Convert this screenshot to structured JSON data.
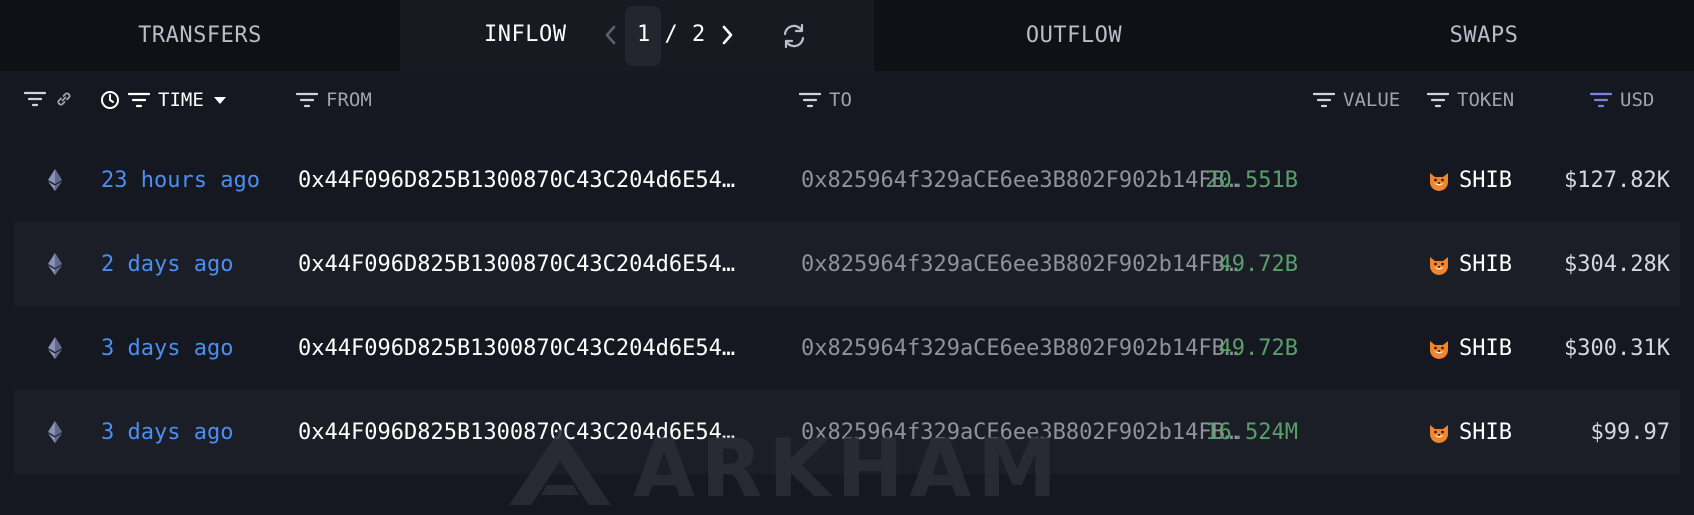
{
  "tabs": {
    "transfers": "TRANSFERS",
    "inflow": "INFLOW",
    "outflow": "OUTFLOW",
    "swaps": "SWAPS"
  },
  "pager": {
    "current": "1",
    "separator": "/",
    "total": "2",
    "display": "1 / 2"
  },
  "columns": {
    "time": "TIME",
    "from": "FROM",
    "to": "TO",
    "value": "VALUE",
    "token": "TOKEN",
    "usd": "USD"
  },
  "rows": [
    {
      "chain_icon": "ethereum-icon",
      "time": "23 hours ago",
      "from": "0x44F096D825B1300870C43C204d6E54…",
      "to": "0x825964f329aCE6ee3B802F902b14FB…",
      "value": "20.551B",
      "token_icon": "shib-icon",
      "token": "SHIB",
      "usd": "$127.82K"
    },
    {
      "chain_icon": "ethereum-icon",
      "time": "2 days ago",
      "from": "0x44F096D825B1300870C43C204d6E54…",
      "to": "0x825964f329aCE6ee3B802F902b14FB…",
      "value": "49.72B",
      "token_icon": "shib-icon",
      "token": "SHIB",
      "usd": "$304.28K"
    },
    {
      "chain_icon": "ethereum-icon",
      "time": "3 days ago",
      "from": "0x44F096D825B1300870C43C204d6E54…",
      "to": "0x825964f329aCE6ee3B802F902b14FB…",
      "value": "49.72B",
      "token_icon": "shib-icon",
      "token": "SHIB",
      "usd": "$300.31K"
    },
    {
      "chain_icon": "ethereum-icon",
      "time": "3 days ago",
      "from": "0x44F096D825B1300870C43C204d6E54…",
      "to": "0x825964f329aCE6ee3B802F902b14FB…",
      "value": "16.524M",
      "token_icon": "shib-icon",
      "token": "SHIB",
      "usd": "$99.97"
    }
  ],
  "watermark": {
    "text": "ARKHAM"
  },
  "colors": {
    "background": "#151820",
    "tab_bg": "#0f1116",
    "active_tab_bg": "#171a21",
    "alt_row_bg": "#1b1e26",
    "time_link": "#4a8ef0",
    "value_green": "#5a9f6b",
    "usd_filter_accent": "#7b84d8"
  }
}
